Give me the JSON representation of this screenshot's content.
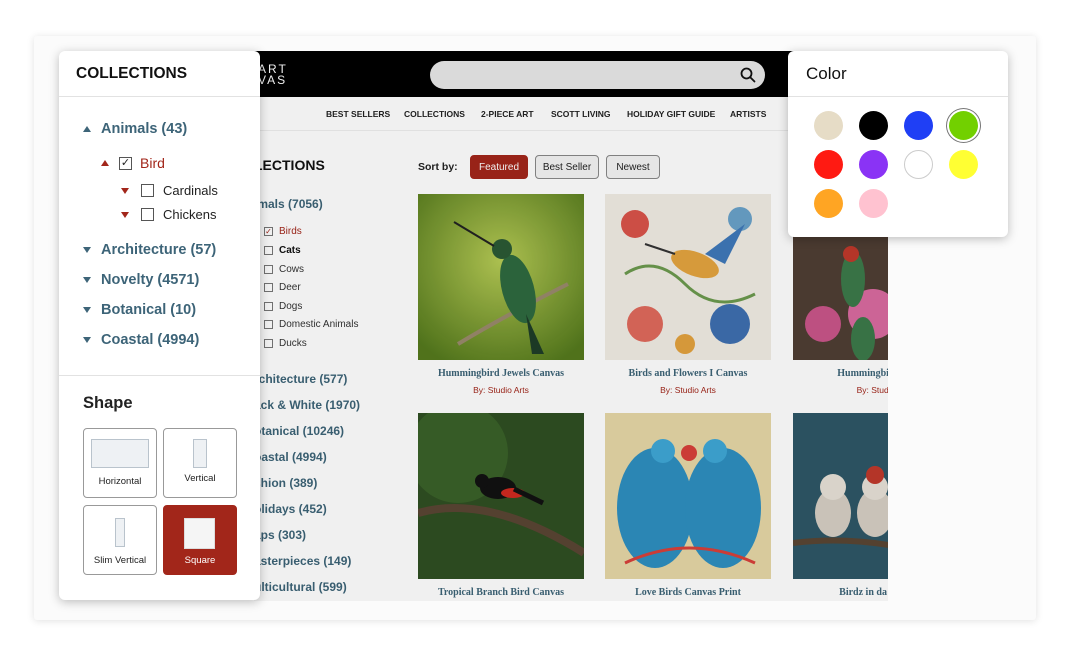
{
  "site": {
    "logo_line1": "ART",
    "logo_line2": "VAS",
    "nav": [
      "BEST SELLERS",
      "COLLECTIONS",
      "2-PIECE ART",
      "SCOTT LIVING",
      "HOLIDAY GIFT GUIDE",
      "ARTISTS"
    ],
    "sidebar": {
      "title": "LECTIONS",
      "animals": "imals (7056)",
      "items": [
        {
          "label": "Birds",
          "checked": true
        },
        {
          "label": "Cats",
          "checked": false
        },
        {
          "label": "Cows",
          "checked": false
        },
        {
          "label": "Deer",
          "checked": false
        },
        {
          "label": "Dogs",
          "checked": false
        },
        {
          "label": "Domestic Animals",
          "checked": false
        },
        {
          "label": "Ducks",
          "checked": false
        }
      ],
      "categories": [
        "rchitecture (577)",
        "ack & White (1970)",
        "otanical (10246)",
        "oastal (4994)",
        "shion (389)",
        "olidays (452)",
        "aps (303)",
        "asterpieces (149)",
        "ulticultural (599)"
      ]
    },
    "sort": {
      "label": "Sort by:",
      "options": [
        "Featured",
        "Best Seller",
        "Newest"
      ],
      "active": "Featured"
    },
    "products": [
      {
        "title": "Hummingbird Jewels Canvas",
        "by": "By: Studio Arts"
      },
      {
        "title": "Birds and Flowers I Canvas",
        "by": "By: Studio Arts"
      },
      {
        "title": "Hummingbirds Je",
        "by": "By: Studio"
      },
      {
        "title": "Tropical Branch Bird Canvas",
        "by": ""
      },
      {
        "title": "Love Birds Canvas Print",
        "by": ""
      },
      {
        "title": "Birdz in da Hood",
        "by": ""
      }
    ]
  },
  "collections_panel": {
    "title": "COLLECTIONS",
    "animals": "Animals (43)",
    "bird": "Bird",
    "bird_checked": true,
    "sub": [
      {
        "label": "Cardinals",
        "checked": false
      },
      {
        "label": "Chickens",
        "checked": false
      }
    ],
    "others": [
      "Architecture (57)",
      "Novelty (4571)",
      "Botanical (10)",
      "Coastal (4994)"
    ],
    "shape_title": "Shape",
    "shapes": [
      "Horizontal",
      "Vertical",
      "Slim Vertical",
      "Square"
    ],
    "active_shape": "Square"
  },
  "color_panel": {
    "title": "Color",
    "swatches": [
      "#e6dcc6",
      "#000000",
      "#1f3ff5",
      "#72d000",
      "#ff1a12",
      "#8a33f5",
      "#ffffff",
      "#ffff33",
      "#ffa523",
      "#ffc2d0"
    ],
    "selected": "#72d000"
  },
  "colors": {
    "accent_red": "#a2261a",
    "link_blue": "#3d6478"
  }
}
